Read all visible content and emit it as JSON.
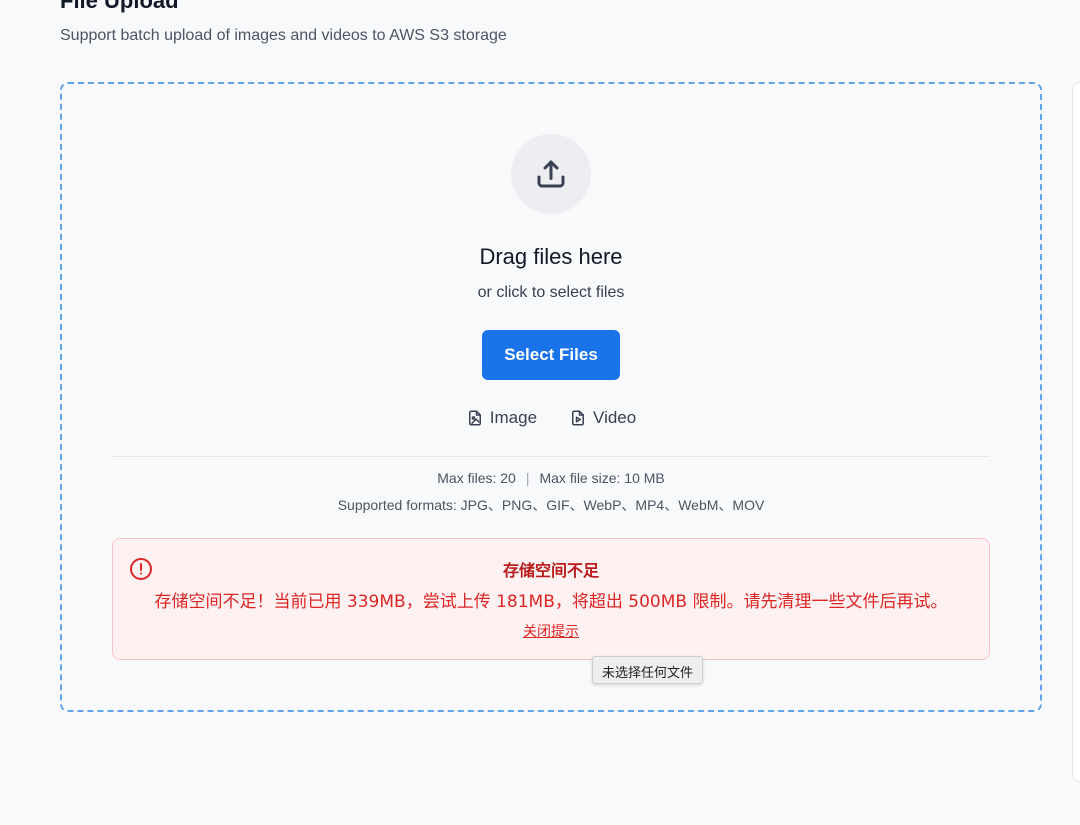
{
  "header": {
    "title": "File Upload",
    "subtitle": "Support batch upload of images and videos to AWS S3 storage"
  },
  "dropzone": {
    "icon": "upload-icon",
    "title": "Drag files here",
    "subtitle": "or click to select files",
    "select_button": "Select Files",
    "types": [
      {
        "label": "Image",
        "icon": "image-file-icon"
      },
      {
        "label": "Video",
        "icon": "video-file-icon"
      }
    ],
    "max_files": "Max files: 20",
    "separator": "|",
    "max_size": "Max file size: 10 MB",
    "formats": "Supported formats: JPG、PNG、GIF、WebP、MP4、WebM、MOV"
  },
  "alert": {
    "icon": "alert-circle-icon",
    "title": "存储空间不足",
    "message": "存储空间不足！当前已用 339MB，尝试上传 181MB，将超出 500MB 限制。请先清理一些文件后再试。",
    "close_label": "关闭提示"
  },
  "tooltip": {
    "text": "未选择任何文件"
  },
  "colors": {
    "accent": "#1a73e8",
    "dropzone_border": "#60a5e8",
    "error_text": "#dc2626",
    "error_bg": "#fef1f1"
  }
}
